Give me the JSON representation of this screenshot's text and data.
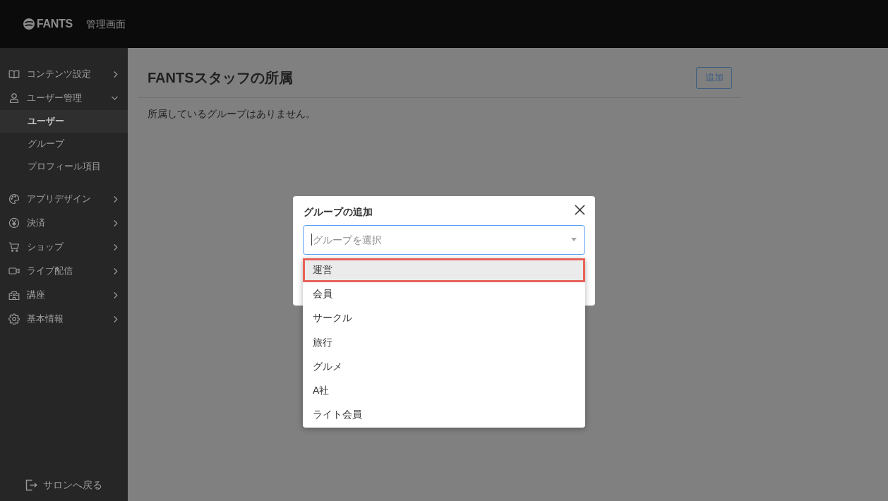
{
  "header": {
    "logo": "FANTS",
    "title": "管理画面"
  },
  "sidebar": {
    "items": [
      {
        "label": "コンテンツ設定",
        "expanded": false
      },
      {
        "label": "ユーザー管理",
        "expanded": true,
        "children": [
          {
            "label": "ユーザー",
            "selected": true
          },
          {
            "label": "グループ",
            "selected": false
          },
          {
            "label": "プロフィール項目",
            "selected": false
          }
        ]
      },
      {
        "label": "アプリデザイン",
        "expanded": false
      },
      {
        "label": "決済",
        "expanded": false
      },
      {
        "label": "ショップ",
        "expanded": false
      },
      {
        "label": "ライブ配信",
        "expanded": false
      },
      {
        "label": "講座",
        "expanded": false
      },
      {
        "label": "基本情報",
        "expanded": false
      }
    ],
    "footer_link": "サロンへ戻る"
  },
  "main": {
    "title": "FANTSスタッフの所属",
    "add_button": "追加",
    "empty_message": "所属しているグループはありません。"
  },
  "modal": {
    "title": "グループの追加",
    "select": {
      "placeholder": "グループを選択",
      "focused": true,
      "options": [
        {
          "label": "運営",
          "selected": true
        },
        {
          "label": "会員",
          "selected": false
        },
        {
          "label": "サークル",
          "selected": false
        },
        {
          "label": "旅行",
          "selected": false
        },
        {
          "label": "グルメ",
          "selected": false
        },
        {
          "label": "A社",
          "selected": false
        },
        {
          "label": "ライト会員",
          "selected": false
        }
      ]
    }
  }
}
